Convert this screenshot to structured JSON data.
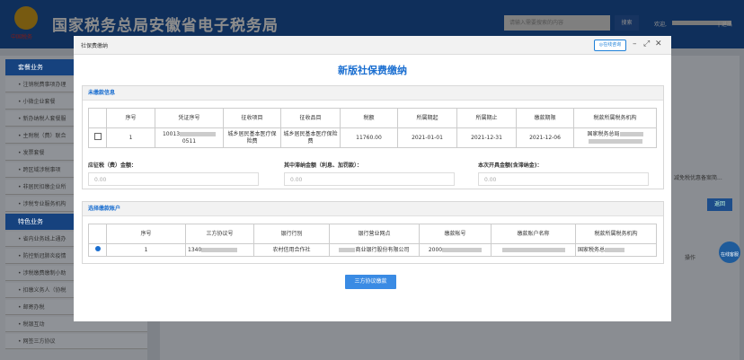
{
  "header": {
    "emblem_caption": "中国税务",
    "site_title": "国家税务总局安徽省电子税务局",
    "search_placeholder": "请输入需要搜索的内容",
    "search_button": "搜索",
    "welcome": "欢迎,",
    "logout": "| 退出"
  },
  "sidebar": {
    "section1": "套餐业务",
    "section1_items": [
      "注销税费事项办理",
      "小微企业套餐",
      "新办纳税人套餐服",
      "主附税（费）联合",
      "发票套餐",
      "跨区域涉税事项",
      "非居民扣缴企业所",
      "涉税专业服务机构"
    ],
    "section2": "特色业务",
    "section2_items": [
      "省内业务线上通办",
      "防控新冠肺炎疫情",
      "涉税缴费缴制小助",
      "扣缴义务人（协税",
      "邮寄办税",
      "税银互动",
      "网签三方协议"
    ]
  },
  "background": {
    "right_text": "减免税优惠备案简...",
    "return_button": "返回",
    "operate_text": "操作",
    "online_help": "在线客服"
  },
  "modal": {
    "window_title": "社保费缴纳",
    "online_button": "在线咨询",
    "main_title": "新版社保费缴纳",
    "section_unpaid": "未缴款信息",
    "unpaid_headers": [
      "序号",
      "凭证序号",
      "征收项目",
      "征收品目",
      "税额",
      "所属期起",
      "所属期止",
      "缴款期限",
      "税款所属税务机构"
    ],
    "unpaid_row": {
      "index": "1",
      "voucher_prefix": "10013",
      "voucher_suffix": "0511",
      "levy_item": "城乡居民基本医疗保险费",
      "levy_subitem": "城乡居民基本医疗保险费",
      "amount": "11760.00",
      "period_start": "2021-01-01",
      "period_end": "2021-12-31",
      "deadline": "2021-12-06",
      "tax_office": "国家税务总局"
    },
    "label_due": "应征税（费）金额：",
    "label_late": "其中滞纳金额（利息、加罚款）：",
    "label_total": "本次开具金额(含滞纳金)：",
    "value_due": "0.00",
    "value_late": "0.00",
    "value_total": "0.00",
    "section_account": "选择缴款账户",
    "account_headers": [
      "序号",
      "三方协议号",
      "银行行别",
      "银行营业网点",
      "缴款帐号",
      "缴款账户名称",
      "税款所属税务机构"
    ],
    "account_row": {
      "index": "1",
      "agreement_no": "1340",
      "bank_type": "农村信用合作社",
      "bank_branch_suffix": "商业银行股份有限公司",
      "account_no": "2000",
      "account_name": "",
      "tax_office": "国家税务总"
    },
    "pay_button": "三方协议缴款"
  },
  "colors": {
    "brand": "#1d56a7",
    "accent": "#1a6ed0",
    "button": "#3a8be4"
  }
}
